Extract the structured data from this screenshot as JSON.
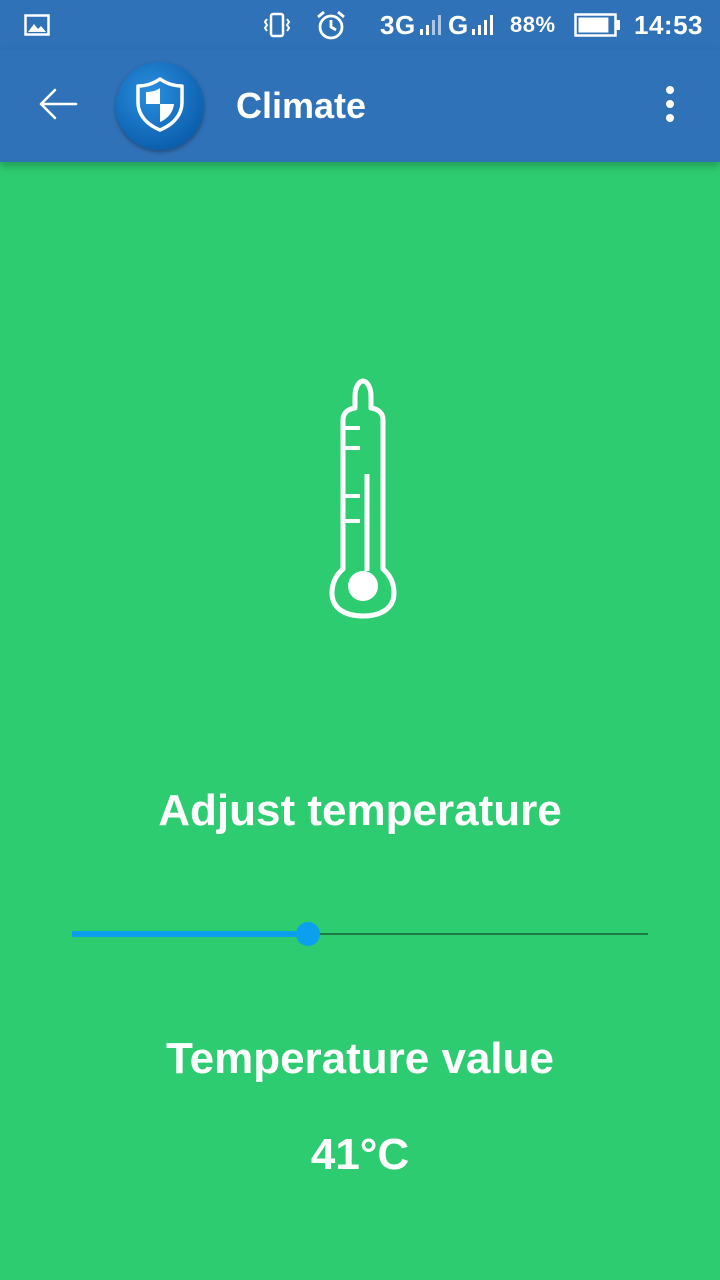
{
  "status_bar": {
    "network_1": "3G",
    "network_2": "G",
    "battery_percent": "88%",
    "battery_level": 0.88,
    "time": "14:53",
    "icons": [
      "gallery-icon",
      "vibrate-icon",
      "alarm-icon",
      "signal-icon",
      "battery-icon"
    ]
  },
  "app_bar": {
    "title": "Climate",
    "icons": [
      "back-arrow-icon",
      "shield-logo-icon",
      "overflow-menu-icon"
    ]
  },
  "main": {
    "icon": "thermometer-icon",
    "adjust_label": "Adjust temperature",
    "slider": {
      "fraction": 0.41
    },
    "value_label": "Temperature value",
    "value": "41°C"
  },
  "colors": {
    "primary": "#3072b8",
    "background": "#2ecc71",
    "accent": "#0aa0ee",
    "text": "#ffffff"
  }
}
